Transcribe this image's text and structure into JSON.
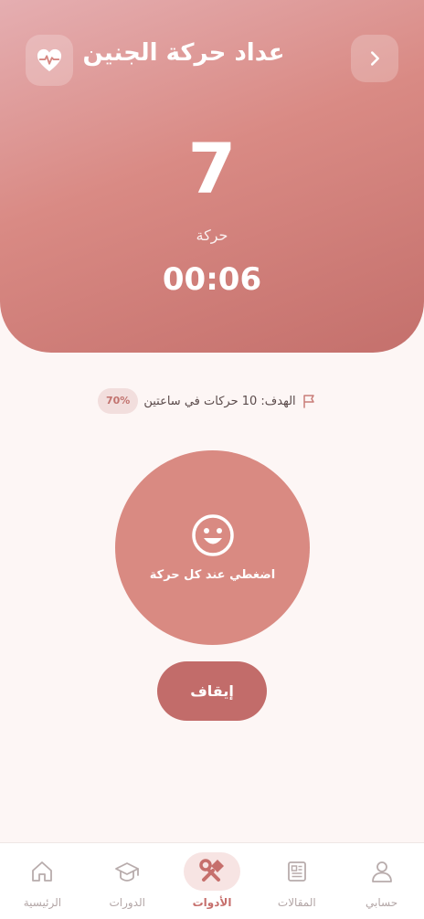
{
  "header": {
    "title": "عداد حركة الجنين",
    "count": "7",
    "count_label": "حركة",
    "timer": "00:06",
    "back_icon": "chevron-right-icon",
    "heart_icon": "heartbeat-icon"
  },
  "goal": {
    "text": "الهدف: 10 حركات في ساعتين",
    "percent": "70%",
    "progress": 0.7,
    "icon": "flag-icon"
  },
  "tap": {
    "label": "اضغطي عند كل حركة",
    "icon": "smile-icon"
  },
  "stop_button": {
    "label": "إيقاف"
  },
  "nav": {
    "items": [
      {
        "label": "حسابي",
        "icon": "user-icon",
        "active": false
      },
      {
        "label": "المقالات",
        "icon": "newspaper-icon",
        "active": false
      },
      {
        "label": "الأدوات",
        "icon": "tools-icon",
        "active": true
      },
      {
        "label": "الدورات",
        "icon": "graduation-cap-icon",
        "active": false
      },
      {
        "label": "الرئيسية",
        "icon": "home-icon",
        "active": false
      }
    ]
  },
  "colors": {
    "accent": "#c26c6a",
    "header_start": "#e5aeb1",
    "header_end": "#c4706c",
    "background": "#fdf6f5",
    "tap_circle": "#d98a82"
  }
}
